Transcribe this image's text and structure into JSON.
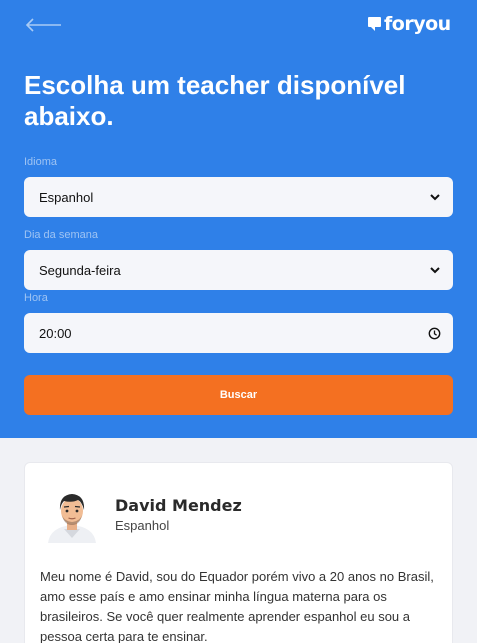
{
  "brand": {
    "name": "foryou"
  },
  "colors": {
    "primary": "#2f80e8",
    "accent": "#f47021",
    "background": "#f1f2f6"
  },
  "icons": {
    "back": "arrow-left-icon",
    "logo": "chat-bubble-icon",
    "select": "chevron-down-icon",
    "time": "clock-icon"
  },
  "header": {
    "title": "Escolha um teacher disponível abaixo."
  },
  "form": {
    "language": {
      "label": "Idioma",
      "value": "Espanhol"
    },
    "weekday": {
      "label": "Dia da semana",
      "value": "Segunda-feira"
    },
    "time": {
      "label": "Hora",
      "value": "20:00"
    },
    "search_label": "Buscar"
  },
  "teachers": [
    {
      "name": "David Mendez",
      "language": "Espanhol",
      "bio": "Meu nome é David, sou do Equador porém vivo a 20 anos no Brasil, amo esse país e amo ensinar minha língua materna para os brasileiros. Se você quer realmente aprender espanhol eu sou a pessoa certa para te ensinar."
    }
  ]
}
